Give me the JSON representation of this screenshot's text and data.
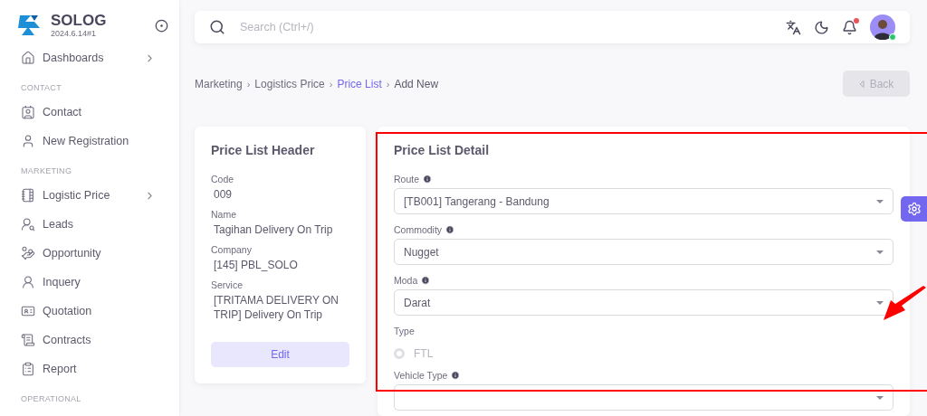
{
  "brand": {
    "name": "SOLOG",
    "version": "2024.6.14#1"
  },
  "sidebar": {
    "sections": [
      {
        "items": [
          {
            "label": "Dashboards",
            "has_submenu": true,
            "selected": false
          }
        ]
      },
      {
        "header": "CONTACT",
        "items": [
          {
            "label": "Contact",
            "has_submenu": false,
            "selected": false
          },
          {
            "label": "New Registration",
            "has_submenu": false,
            "selected": false
          }
        ]
      },
      {
        "header": "MARKETING",
        "items": [
          {
            "label": "Logistic Price",
            "has_submenu": true,
            "selected": false
          },
          {
            "label": "Leads",
            "has_submenu": false,
            "selected": false
          },
          {
            "label": "Opportunity",
            "has_submenu": false,
            "selected": false
          },
          {
            "label": "Inquery",
            "has_submenu": false,
            "selected": false
          },
          {
            "label": "Quotation",
            "has_submenu": false,
            "selected": false
          },
          {
            "label": "Contracts",
            "has_submenu": false,
            "selected": false
          },
          {
            "label": "Report",
            "has_submenu": false,
            "selected": false
          }
        ]
      },
      {
        "header": "OPERATIONAL"
      }
    ]
  },
  "topbar": {
    "search": {
      "placeholder": "Search (Ctrl+/)"
    },
    "notifications": {
      "has_unread": true
    },
    "user": {
      "online": true
    }
  },
  "breadcrumb": {
    "separators": [
      "›",
      "›",
      "›"
    ],
    "items": [
      {
        "label": "Marketing",
        "current": false,
        "link": false
      },
      {
        "label": "Logistics Price",
        "current": false,
        "link": false
      },
      {
        "label": "Price List",
        "current": false,
        "link": true
      },
      {
        "label": "Add New",
        "current": true,
        "link": false
      }
    ]
  },
  "back_button": {
    "label": "Back",
    "disabled": true
  },
  "header_card": {
    "title": "Price List Header",
    "fields": [
      {
        "label": "Code",
        "value": "009"
      },
      {
        "label": "Name",
        "value": "Tagihan Delivery On Trip"
      },
      {
        "label": "Company",
        "value": "[145] PBL_SOLO"
      },
      {
        "label": "Service",
        "value": "[TRITAMA DELIVERY ON TRIP] Delivery On Trip"
      }
    ],
    "edit_button": "Edit"
  },
  "detail_card": {
    "title": "Price List Detail",
    "fields": [
      {
        "kind": "select",
        "label": "Route",
        "info": true,
        "value": "[TB001] Tangerang - Bandung"
      },
      {
        "kind": "select",
        "label": "Commodity",
        "info": true,
        "value": "Nugget"
      },
      {
        "kind": "select",
        "label": "Moda",
        "info": true,
        "value": "Darat"
      },
      {
        "kind": "radio",
        "label": "Type",
        "info": false,
        "options": [
          {
            "label": "FTL",
            "selected": false,
            "disabled": true
          }
        ]
      },
      {
        "kind": "select",
        "label": "Vehicle Type",
        "info": true
      }
    ]
  },
  "annotation": {
    "highlight": true
  }
}
